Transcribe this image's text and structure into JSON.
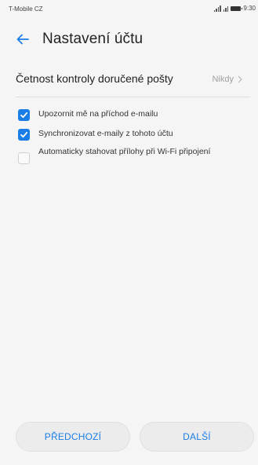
{
  "status_bar": {
    "carrier": "T-Mobile CZ",
    "time": "9:30"
  },
  "header": {
    "title": "Nastavení účtu"
  },
  "frequency": {
    "label": "Četnost kontroly doručené pošty",
    "value": "Nikdy"
  },
  "options": [
    {
      "label": "Upozornit mě na příchod e-mailu",
      "checked": true
    },
    {
      "label": "Synchronizovat e-maily z tohoto účtu",
      "checked": true
    },
    {
      "label": "Automaticky stahovat přílohy při Wi-Fi připojení",
      "checked": false
    }
  ],
  "buttons": {
    "previous": "PŘEDCHOZÍ",
    "next": "DALŠÍ"
  },
  "colors": {
    "accent": "#1a7ee6",
    "background": "#f5f5f5"
  }
}
